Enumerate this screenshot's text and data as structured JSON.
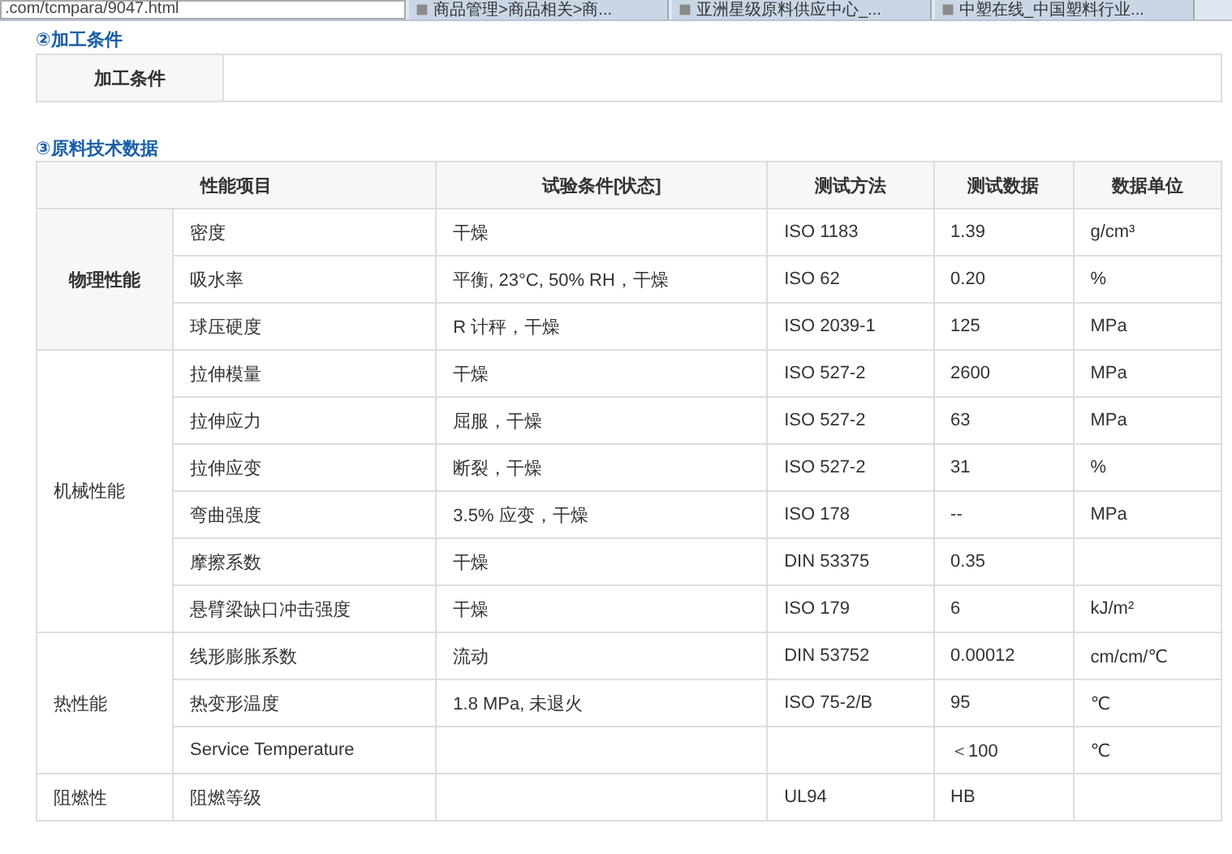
{
  "browser": {
    "address": ".com/tcmpara/9047.html",
    "tabs": [
      {
        "title": "商品管理>商品相关>商..."
      },
      {
        "title": "亚洲星级原料供应中心_..."
      },
      {
        "title": "中塑在线_中国塑料行业..."
      }
    ]
  },
  "processing": {
    "heading": "②加工条件",
    "label": "加工条件"
  },
  "tech_data": {
    "heading": "③原料技术数据",
    "columns": [
      "性能项目",
      "试验条件[状态]",
      "测试方法",
      "测试数据",
      "数据单位"
    ],
    "groups": [
      {
        "name": "物理性能",
        "highlighted": true,
        "rows": [
          {
            "property": "密度",
            "condition": "干燥",
            "method": "ISO 1183",
            "value": "1.39",
            "unit": "g/cm³"
          },
          {
            "property": "吸水率",
            "condition": "平衡, 23°C, 50% RH，干燥",
            "method": "ISO 62",
            "value": "0.20",
            "unit": "%"
          },
          {
            "property": "球压硬度",
            "condition": "R 计秤，干燥",
            "method": "ISO 2039-1",
            "value": "125",
            "unit": "MPa"
          }
        ]
      },
      {
        "name": "机械性能",
        "highlighted": false,
        "rows": [
          {
            "property": "拉伸模量",
            "condition": "干燥",
            "method": "ISO 527-2",
            "value": "2600",
            "unit": "MPa"
          },
          {
            "property": "拉伸应力",
            "condition": "屈服，干燥",
            "method": "ISO 527-2",
            "value": "63",
            "unit": "MPa"
          },
          {
            "property": "拉伸应变",
            "condition": "断裂，干燥",
            "method": "ISO 527-2",
            "value": "31",
            "unit": "%"
          },
          {
            "property": "弯曲强度",
            "condition": "3.5% 应变，干燥",
            "method": "ISO 178",
            "value": "--",
            "unit": "MPa"
          },
          {
            "property": "摩擦系数",
            "condition": "干燥",
            "method": "DIN 53375",
            "value": "0.35"
          },
          {
            "property": "悬臂梁缺口冲击强度",
            "condition": "干燥",
            "method": "ISO 179",
            "value": "6",
            "unit": "kJ/m²"
          }
        ]
      },
      {
        "name": "热性能",
        "highlighted": false,
        "rows": [
          {
            "property": "线形膨胀系数",
            "condition": "流动",
            "method": "DIN 53752",
            "value": "0.00012",
            "unit": "cm/cm/℃"
          },
          {
            "property": "热变形温度",
            "condition": "1.8 MPa, 未退火",
            "method": "ISO 75-2/B",
            "value": "95",
            "unit": "℃"
          },
          {
            "property": "Service Temperature",
            "value": "＜100",
            "unit": "℃"
          }
        ]
      },
      {
        "name": "阻燃性",
        "highlighted": false,
        "rows": [
          {
            "property": "阻燃等级",
            "method": "UL94",
            "value": "HB"
          }
        ]
      }
    ]
  }
}
